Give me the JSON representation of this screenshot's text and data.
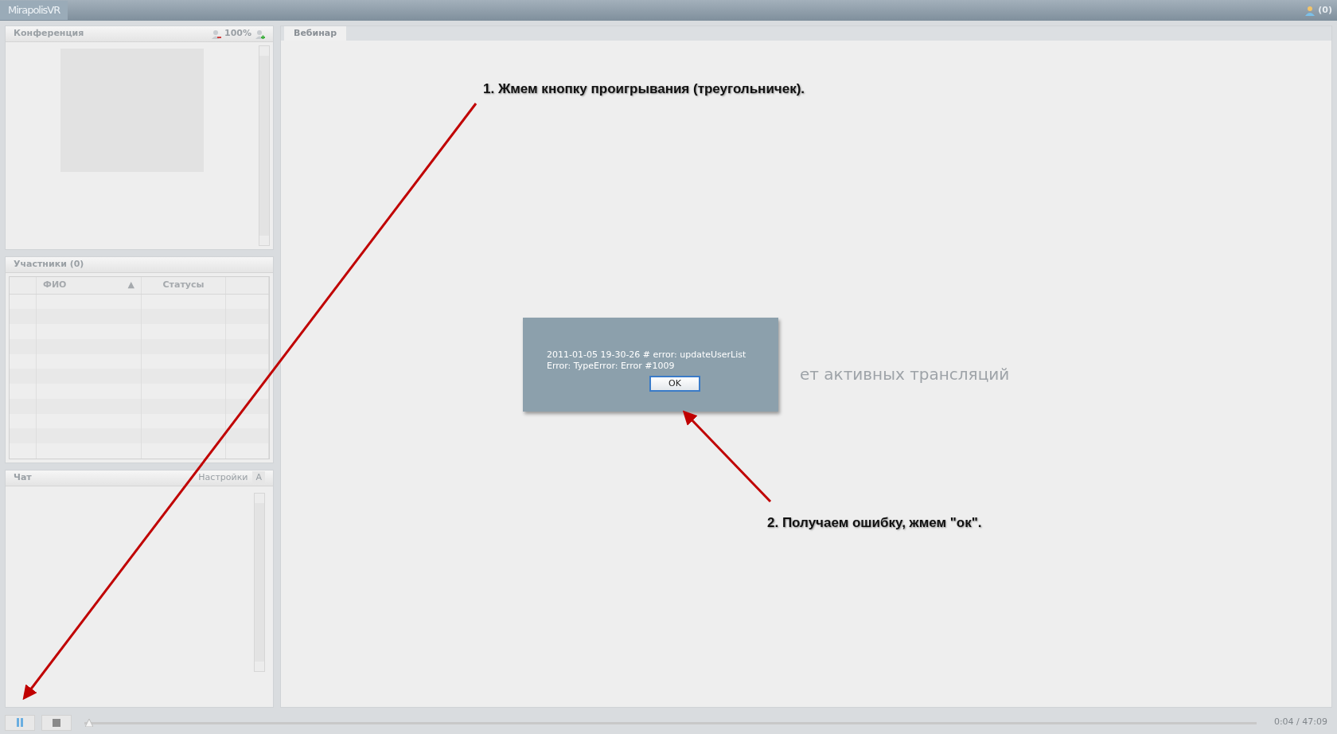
{
  "app": {
    "logo": "MirapolisVR",
    "user_count": "(0)"
  },
  "conference": {
    "title": "Конференция",
    "zoom": "100%"
  },
  "participants": {
    "title": "Участники (0)",
    "columns": [
      {
        "label": "ФИО",
        "sort_mark": "▲"
      },
      {
        "label": "Статусы"
      }
    ]
  },
  "chat": {
    "title": "Чат",
    "settings": "Настройки",
    "font_button": "A"
  },
  "tabs": [
    {
      "label": "Вебинар",
      "selected": true
    }
  ],
  "empty_message": "ет активных трансляций",
  "dialog": {
    "lines": [
      "2011-01-05 19-30-26 # error: updateUserList",
      "Error: TypeError: Error #1009"
    ],
    "button": "OK"
  },
  "player": {
    "level": 0.001,
    "time": "0:04 / 47:09"
  },
  "annotations": [
    {
      "text": "1. Жмем кнопку проигрывания (треугольничек)."
    },
    {
      "text": "2. Получаем ошибку, жмем \"ок\"."
    }
  ]
}
